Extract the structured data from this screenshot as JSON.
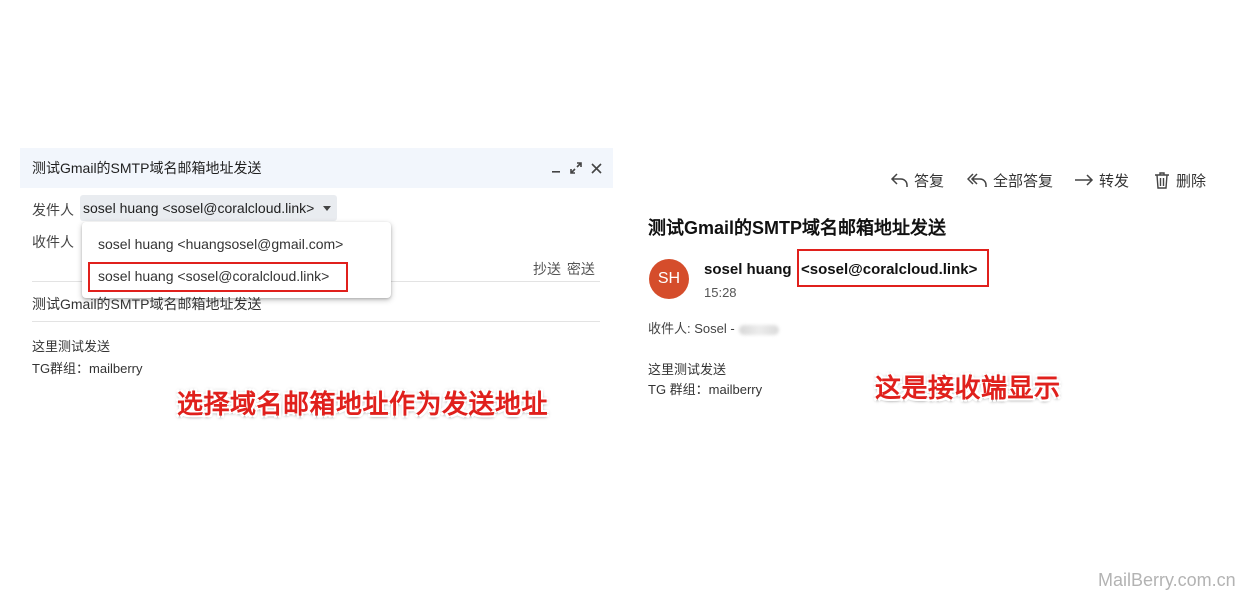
{
  "compose": {
    "title": "测试Gmail的SMTP域名邮箱地址发送",
    "from_label": "发件人",
    "from_value": "sosel huang <sosel@coralcloud.link>",
    "to_label": "收件人",
    "cc_bcc": "抄送 密送",
    "subject": "测试Gmail的SMTP域名邮箱地址发送",
    "body_line1": "这里测试发送",
    "body_line2": "TG群组：mailberry",
    "from_options": [
      "sosel huang <huangsosel@gmail.com>",
      "sosel huang <sosel@coralcloud.link>"
    ]
  },
  "captions": {
    "left": "选择域名邮箱地址作为发送地址",
    "right": "这是接收端显示"
  },
  "received": {
    "actions": {
      "reply": "答复",
      "reply_all": "全部答复",
      "forward": "转发",
      "delete": "删除"
    },
    "subject": "测试Gmail的SMTP域名邮箱地址发送",
    "avatar_initials": "SH",
    "avatar_color": "#d54d2b",
    "sender_name": "sosel huang",
    "sender_email": "<sosel@coralcloud.link>",
    "time": "15:28",
    "to_line": "收件人: Sosel -",
    "body_line1": "这里测试发送",
    "body_line2": "TG 群组：mailberry"
  },
  "watermark": "MailBerry.com.cn",
  "colors": {
    "highlight_red": "#e0201c",
    "compose_header_bg": "#f2f6fc"
  }
}
